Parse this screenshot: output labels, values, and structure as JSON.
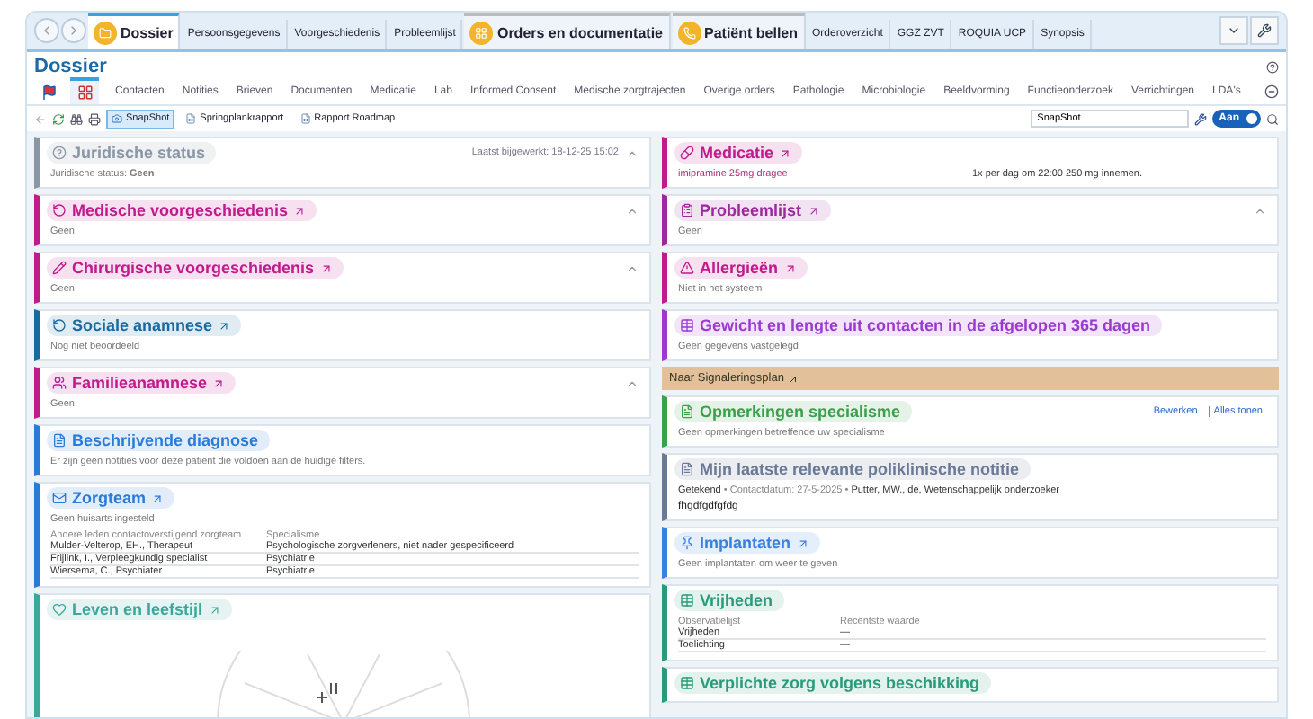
{
  "top_tabs": [
    {
      "label": "Dossier",
      "kind": "main",
      "selected": true
    },
    {
      "label": "Persoonsgegevens",
      "kind": "plain",
      "selected": false
    },
    {
      "label": "Voorgeschiedenis",
      "kind": "plain",
      "selected": false
    },
    {
      "label": "Probleemlijst",
      "kind": "plain",
      "selected": false
    },
    {
      "label": "Orders en documentatie",
      "kind": "main",
      "selected": false
    },
    {
      "label": "Patiënt bellen",
      "kind": "main",
      "selected": false
    },
    {
      "label": "Orderoverzicht",
      "kind": "plain",
      "selected": false
    },
    {
      "label": "GGZ ZVT",
      "kind": "plain",
      "selected": false
    },
    {
      "label": "ROQUIA UCP",
      "kind": "plain",
      "selected": false
    },
    {
      "label": "Synopsis",
      "kind": "plain",
      "selected": false
    }
  ],
  "page_title": "Dossier",
  "icon_tabs": [
    {
      "selected": false
    },
    {
      "selected": true
    }
  ],
  "subtabs": [
    {
      "label": "Contacten",
      "selected": false
    },
    {
      "label": "Notities",
      "selected": false
    },
    {
      "label": "Brieven",
      "selected": false
    },
    {
      "label": "Documenten",
      "selected": false
    },
    {
      "label": "Medicatie",
      "selected": false
    },
    {
      "label": "Lab",
      "selected": false
    },
    {
      "label": "Informed Consent",
      "selected": false
    },
    {
      "label": "Medische zorgtrajecten",
      "selected": false
    },
    {
      "label": "Overige orders",
      "selected": false
    },
    {
      "label": "Pathologie",
      "selected": false
    },
    {
      "label": "Microbiologie",
      "selected": false
    },
    {
      "label": "Beeldvorming",
      "selected": false
    },
    {
      "label": "Functieonderzoek",
      "selected": false
    },
    {
      "label": "Verrichtingen",
      "selected": false
    },
    {
      "label": "LDA's",
      "selected": false
    }
  ],
  "toolbar": {
    "buttons": [
      {
        "label": "SnapShot",
        "selected": true
      },
      {
        "label": "Springplankrapport",
        "selected": false
      },
      {
        "label": "Rapport Roadmap",
        "selected": false
      }
    ],
    "field": "SnapShot",
    "toggle": {
      "label": "Aan",
      "on": true
    }
  },
  "left_cards": [
    {
      "kind": "section",
      "title": "Juridische status",
      "color": "#8a96a6",
      "link": false,
      "collapsible": true,
      "updated": "Laatst bijgewerkt: 18-12-25 15:02",
      "text": "Juridische status: **Geen**"
    },
    {
      "kind": "section",
      "title": "Medische voorgeschiedenis",
      "color": "#c01a8c",
      "link": true,
      "collapsible": true,
      "text": "Geen"
    },
    {
      "kind": "section",
      "title": "Chirurgische voorgeschiedenis",
      "color": "#c01a8c",
      "link": true,
      "collapsible": true,
      "text": "Geen"
    },
    {
      "kind": "section",
      "title": "Sociale anamnese",
      "color": "#1a6aa0",
      "link": true,
      "collapsible": false,
      "text": "Nog niet beoordeeld"
    },
    {
      "kind": "section",
      "title": "Familieanamnese",
      "color": "#c01a8c",
      "link": true,
      "collapsible": true,
      "text": "Geen"
    },
    {
      "kind": "section",
      "title": "Beschrijvende diagnose",
      "color": "#2a7ad8",
      "link": false,
      "collapsible": false,
      "text": "Er zijn geen notities voor deze patient die voldoen aan de huidige filters."
    },
    {
      "kind": "section",
      "title": "Zorgteam",
      "color": "#2a7ad8",
      "link": true,
      "collapsible": false,
      "text": "Geen huisarts ingesteld",
      "table": {
        "head": [
          "Andere leden contactoverstijgend zorgteam",
          "Specialisme"
        ],
        "rows": [
          [
            "Mulder-Velterop, EH., Therapeut",
            "Psychologische zorgverleners, niet nader gespecificeerd"
          ],
          [
            "Frijlink, I., Verpleegkundig specialist",
            "Psychiatrie"
          ],
          [
            "Wiersema, C., Psychiater",
            "Psychiatrie"
          ]
        ]
      }
    },
    {
      "kind": "wheel",
      "title": "Leven en leefstijl",
      "color": "#3aa89a",
      "link": true,
      "collapsible": false
    }
  ],
  "right_cards": [
    {
      "kind": "section",
      "title": "Medicatie",
      "color": "#c01a8c",
      "link": true,
      "collapsible": false,
      "medication": [
        "imipramine 25mg dragee",
        "1x per dag om 22:00 250 mg innemen."
      ]
    },
    {
      "kind": "section",
      "title": "Probleemlijst",
      "color": "#9c2a9c",
      "link": true,
      "collapsible": true,
      "text": "Geen"
    },
    {
      "kind": "section",
      "title": "Allergieën",
      "color": "#c01a8c",
      "link": true,
      "collapsible": false,
      "text": "Niet in het systeem"
    },
    {
      "kind": "section",
      "title": "Gewicht en lengte uit contacten in de afgelopen 365 dagen",
      "color": "#9a3ad0",
      "link": false,
      "collapsible": false,
      "text": "Geen gegevens vastgelegd"
    },
    {
      "kind": "banner",
      "title": "Naar Signaleringsplan",
      "color": "#e2c09a",
      "link": true
    },
    {
      "kind": "section",
      "title": "Opmerkingen specialisme",
      "color": "#3aa04a",
      "link": false,
      "collapsible": false,
      "actions": [
        "Bewerken",
        "Alles tonen"
      ],
      "text": "Geen opmerkingen betreffende uw specialisme"
    },
    {
      "kind": "section",
      "title": "Mijn laatste relevante poliklinische notitie",
      "color": "#6a7a96",
      "link": false,
      "collapsible": false,
      "meta": "**Getekend** • Contactdatum: 27-5-2025 • **Putter, MW., de, Wetenschappelijk onderzoeker**",
      "note": "fhgdfgdfgfdg"
    },
    {
      "kind": "section",
      "title": "Implantaten",
      "color": "#3a80e0",
      "link": true,
      "collapsible": false,
      "text": "Geen implantaten om weer te geven"
    },
    {
      "kind": "section",
      "title": "Vrijheden",
      "color": "#2a9a7a",
      "link": false,
      "collapsible": false,
      "table": {
        "head": [
          "Observatielijst",
          "Recentste waarde"
        ],
        "rows": [
          [
            "Vrijheden",
            "—"
          ],
          [
            "Toelichting",
            "—"
          ]
        ]
      }
    },
    {
      "kind": "section",
      "title": "Verplichte zorg volgens beschikking",
      "color": "#2a9a7a",
      "link": false,
      "collapsible": false
    }
  ]
}
